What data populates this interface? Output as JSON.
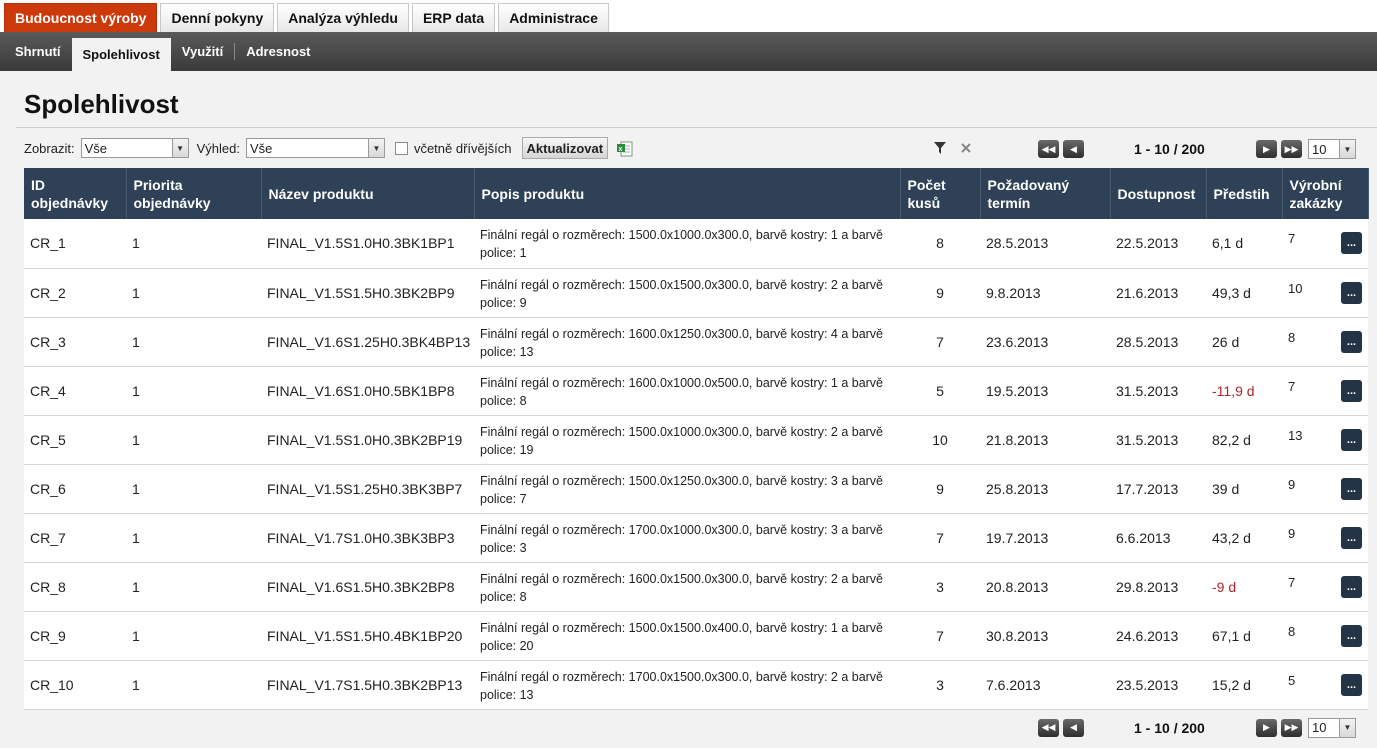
{
  "top_tabs": [
    "Budoucnost výroby",
    "Denní pokyny",
    "Analýza výhledu",
    "ERP data",
    "Administrace"
  ],
  "sub_tabs": [
    "Shrnutí",
    "Spolehlivost",
    "Využití",
    "Adresnost"
  ],
  "page_title": "Spolehlivost",
  "toolbar": {
    "show_label": "Zobrazit:",
    "show_value": "Vše",
    "outlook_label": "Výhled:",
    "outlook_value": "Vše",
    "include_earlier_label": "včetně dřívějších",
    "update_label": "Aktualizovat"
  },
  "pager": {
    "range": "1 - 10 / 200",
    "page_size": "10"
  },
  "table": {
    "headers": {
      "id": "ID objednávky",
      "priority": "Priorita objednávky",
      "product": "Název produktu",
      "description": "Popis produktu",
      "count": "Počet kusů",
      "required": "Požadovaný termín",
      "available": "Dostupnost",
      "lead": "Předstih",
      "orders": "Výrobní zakázky"
    },
    "rows": [
      {
        "id": "CR_1",
        "priority": "1",
        "product": "FINAL_V1.5S1.0H0.3BK1BP1",
        "description": "Finální regál o rozměrech: 1500.0x1000.0x300.0, barvě kostry: 1 a barvě police: 1",
        "count": "8",
        "required": "28.5.2013",
        "available": "22.5.2013",
        "lead": "6,1 d",
        "orders": "7",
        "more": "..."
      },
      {
        "id": "CR_2",
        "priority": "1",
        "product": "FINAL_V1.5S1.5H0.3BK2BP9",
        "description": "Finální regál o rozměrech: 1500.0x1500.0x300.0, barvě kostry: 2 a barvě police: 9",
        "count": "9",
        "required": "9.8.2013",
        "available": "21.6.2013",
        "lead": "49,3 d",
        "orders": "10",
        "more": "..."
      },
      {
        "id": "CR_3",
        "priority": "1",
        "product": "FINAL_V1.6S1.25H0.3BK4BP13",
        "description": "Finální regál o rozměrech: 1600.0x1250.0x300.0, barvě kostry: 4 a barvě police: 13",
        "count": "7",
        "required": "23.6.2013",
        "available": "28.5.2013",
        "lead": "26 d",
        "orders": "8",
        "more": "..."
      },
      {
        "id": "CR_4",
        "priority": "1",
        "product": "FINAL_V1.6S1.0H0.5BK1BP8",
        "description": "Finální regál o rozměrech: 1600.0x1000.0x500.0, barvě kostry: 1 a barvě police: 8",
        "count": "5",
        "required": "19.5.2013",
        "available": "31.5.2013",
        "lead": "-11,9 d",
        "orders": "7",
        "more": "..."
      },
      {
        "id": "CR_5",
        "priority": "1",
        "product": "FINAL_V1.5S1.0H0.3BK2BP19",
        "description": "Finální regál o rozměrech: 1500.0x1000.0x300.0, barvě kostry: 2 a barvě police: 19",
        "count": "10",
        "required": "21.8.2013",
        "available": "31.5.2013",
        "lead": "82,2 d",
        "orders": "13",
        "more": "..."
      },
      {
        "id": "CR_6",
        "priority": "1",
        "product": "FINAL_V1.5S1.25H0.3BK3BP7",
        "description": "Finální regál o rozměrech: 1500.0x1250.0x300.0, barvě kostry: 3 a barvě police: 7",
        "count": "9",
        "required": "25.8.2013",
        "available": "17.7.2013",
        "lead": "39 d",
        "orders": "9",
        "more": "..."
      },
      {
        "id": "CR_7",
        "priority": "1",
        "product": "FINAL_V1.7S1.0H0.3BK3BP3",
        "description": "Finální regál o rozměrech: 1700.0x1000.0x300.0, barvě kostry: 3 a barvě police: 3",
        "count": "7",
        "required": "19.7.2013",
        "available": "6.6.2013",
        "lead": "43,2 d",
        "orders": "9",
        "more": "..."
      },
      {
        "id": "CR_8",
        "priority": "1",
        "product": "FINAL_V1.6S1.5H0.3BK2BP8",
        "description": "Finální regál o rozměrech: 1600.0x1500.0x300.0, barvě kostry: 2 a barvě police: 8",
        "count": "3",
        "required": "20.8.2013",
        "available": "29.8.2013",
        "lead": "-9 d",
        "orders": "7",
        "more": "..."
      },
      {
        "id": "CR_9",
        "priority": "1",
        "product": "FINAL_V1.5S1.5H0.4BK1BP20",
        "description": "Finální regál o rozměrech: 1500.0x1500.0x400.0, barvě kostry: 1 a barvě police: 20",
        "count": "7",
        "required": "30.8.2013",
        "available": "24.6.2013",
        "lead": "67,1 d",
        "orders": "8",
        "more": "..."
      },
      {
        "id": "CR_10",
        "priority": "1",
        "product": "FINAL_V1.7S1.5H0.3BK2BP13",
        "description": "Finální regál o rozměrech: 1700.0x1500.0x300.0, barvě kostry: 2 a barvě police: 13",
        "count": "3",
        "required": "7.6.2013",
        "available": "23.5.2013",
        "lead": "15,2 d",
        "orders": "5",
        "more": "..."
      }
    ]
  },
  "colors": {
    "accent": "#cc3a0c",
    "header_bg": "#2f4156",
    "negative": "#b2242a"
  }
}
